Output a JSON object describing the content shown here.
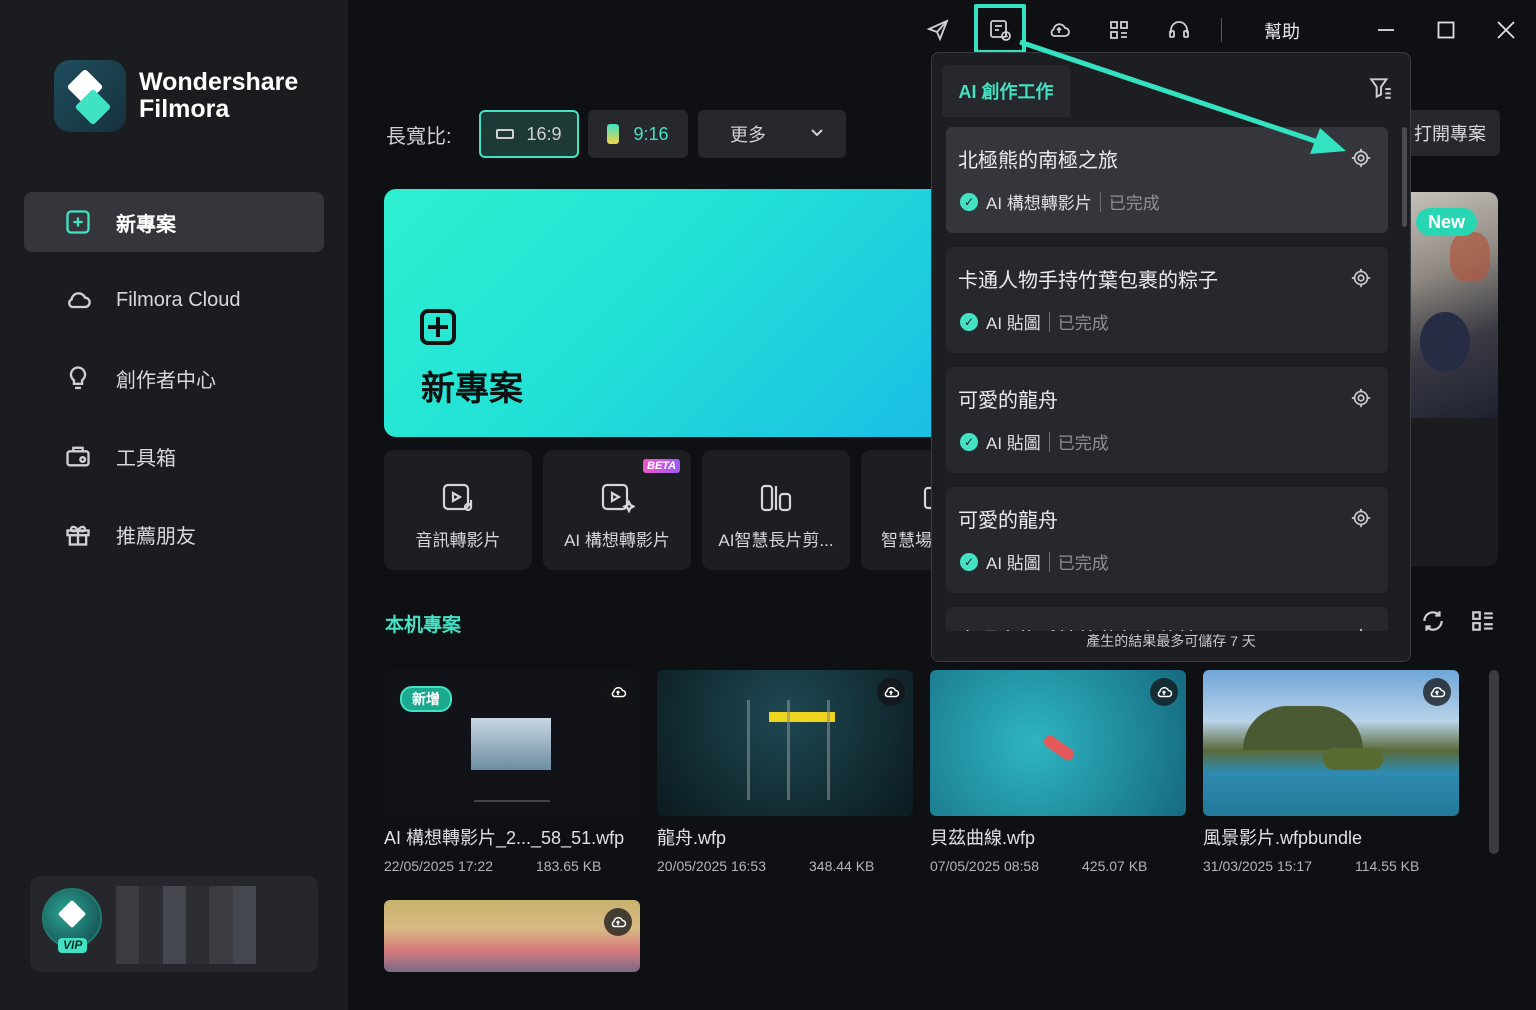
{
  "app": {
    "brand_line1": "Wondershare",
    "brand_line2": "Filmora"
  },
  "sidebar": {
    "items": [
      {
        "label": "新專案",
        "icon": "new-project-icon"
      },
      {
        "label": "Filmora Cloud",
        "icon": "cloud-icon"
      },
      {
        "label": "創作者中心",
        "icon": "lightbulb-icon"
      },
      {
        "label": "工具箱",
        "icon": "toolbox-icon"
      },
      {
        "label": "推薦朋友",
        "icon": "gift-icon"
      }
    ],
    "vip_label": "VIP"
  },
  "topbar": {
    "help_label": "幫助"
  },
  "aspect": {
    "label": "長寬比:",
    "option_169": "16:9",
    "option_916": "9:16",
    "more_label": "更多"
  },
  "open_project_label": "打開專案",
  "hero": {
    "title": "新專案"
  },
  "promo": {
    "badge": "New"
  },
  "tools": [
    {
      "label": "音訊轉影片"
    },
    {
      "label": "AI 構想轉影片",
      "badge": "BETA"
    },
    {
      "label": "AI智慧長片剪..."
    },
    {
      "label": "智慧場"
    }
  ],
  "local_projects": {
    "title": "本机專案",
    "items": [
      {
        "name": "AI 構想轉影片_2..._58_51.wfp",
        "date": "22/05/2025 17:22",
        "size": "183.65 KB",
        "badge": "新增"
      },
      {
        "name": "龍舟.wfp",
        "date": "20/05/2025 16:53",
        "size": "348.44 KB"
      },
      {
        "name": "貝茲曲線.wfp",
        "date": "07/05/2025 08:58",
        "size": "425.07 KB"
      },
      {
        "name": "風景影片.wfpbundle",
        "date": "31/03/2025 15:17",
        "size": "114.55 KB"
      }
    ]
  },
  "ai_panel": {
    "tab_label": "AI 創作工作",
    "items": [
      {
        "title": "北極熊的南極之旅",
        "type": "AI 構想轉影片",
        "status": "已完成"
      },
      {
        "title": "卡通人物手持竹葉包裹的粽子",
        "type": "AI 貼圖",
        "status": "已完成"
      },
      {
        "title": "可愛的龍舟",
        "type": "AI 貼圖",
        "status": "已完成"
      },
      {
        "title": "可愛的龍舟",
        "type": "AI 貼圖",
        "status": "已完成"
      },
      {
        "title": "卡通人物手持竹葉包裹的粽子"
      }
    ],
    "footer": "產生的結果最多可儲存 7 天"
  },
  "colors": {
    "accent": "#43e2c2",
    "highlight": "#32e2c0",
    "sidebar_bg": "#1b1c20",
    "page_bg": "#0f1013"
  }
}
